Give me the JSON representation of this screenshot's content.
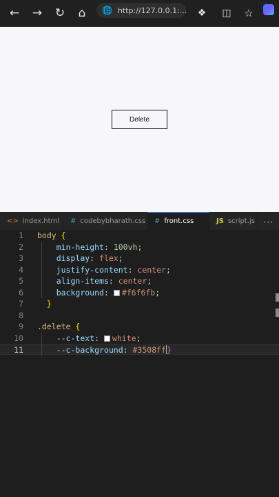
{
  "browser": {
    "address": "http://127.0.0.1:...",
    "icons": [
      "back-icon",
      "forward-icon",
      "refresh-icon",
      "home-icon",
      "globe-icon",
      "extensions-icon",
      "split-screen-icon",
      "favorites-icon",
      "copilot-icon"
    ]
  },
  "page": {
    "button_label": "Delete",
    "background": "#f6f6fb"
  },
  "tabs": [
    {
      "label": "index.html",
      "icon": "html-icon"
    },
    {
      "label": "codebybharath.css",
      "icon": "css-hash-icon"
    },
    {
      "label": "front.css",
      "icon": "css-hash-icon",
      "active": true,
      "unsaved": true
    },
    {
      "label": "script.js",
      "icon": "js-icon"
    }
  ],
  "tab_icons": {
    "html": "<>",
    "css": "#",
    "js": "JS",
    "more": "···"
  },
  "editor": {
    "lines": [
      {
        "n": "1",
        "t": [
          [
            "sel",
            "body "
          ],
          [
            "brace",
            "{"
          ]
        ]
      },
      {
        "n": "2",
        "t": [
          [
            "plain",
            "    "
          ],
          [
            "prop",
            "min-height"
          ],
          [
            "plain",
            ": "
          ],
          [
            "num",
            "100vh"
          ],
          [
            "plain",
            ";"
          ]
        ]
      },
      {
        "n": "3",
        "t": [
          [
            "plain",
            "    "
          ],
          [
            "prop",
            "display"
          ],
          [
            "plain",
            ": "
          ],
          [
            "val",
            "flex"
          ],
          [
            "plain",
            ";"
          ]
        ]
      },
      {
        "n": "4",
        "t": [
          [
            "plain",
            "    "
          ],
          [
            "prop",
            "justify-content"
          ],
          [
            "plain",
            ": "
          ],
          [
            "val",
            "center"
          ],
          [
            "plain",
            ";"
          ]
        ]
      },
      {
        "n": "5",
        "t": [
          [
            "plain",
            "    "
          ],
          [
            "prop",
            "align-items"
          ],
          [
            "plain",
            ": "
          ],
          [
            "val",
            "center"
          ],
          [
            "plain",
            ";"
          ]
        ]
      },
      {
        "n": "6",
        "t": [
          [
            "plain",
            "    "
          ],
          [
            "prop",
            "background"
          ],
          [
            "plain",
            ": "
          ],
          [
            "swatch",
            "#f6f6fb"
          ],
          [
            "val",
            "#f6f6fb"
          ],
          [
            "plain",
            ";"
          ]
        ]
      },
      {
        "n": "7",
        "t": [
          [
            "plain",
            "  "
          ],
          [
            "brace",
            "}"
          ]
        ]
      },
      {
        "n": "8",
        "t": []
      },
      {
        "n": "9",
        "t": [
          [
            "sel",
            ".delete "
          ],
          [
            "brace",
            "{"
          ]
        ]
      },
      {
        "n": "10",
        "t": [
          [
            "plain",
            "    "
          ],
          [
            "prop",
            "--c-text"
          ],
          [
            "plain",
            ": "
          ],
          [
            "swatch",
            "#ffffff"
          ],
          [
            "val",
            "white"
          ],
          [
            "plain",
            ";"
          ]
        ]
      },
      {
        "n": "11",
        "t": [
          [
            "plain",
            "    "
          ],
          [
            "prop",
            "--c-background"
          ],
          [
            "plain",
            ": "
          ],
          [
            "val",
            "#3508ff"
          ],
          [
            "cursor",
            ""
          ],
          [
            "brace2",
            "}"
          ]
        ]
      }
    ],
    "current_line": "11"
  }
}
